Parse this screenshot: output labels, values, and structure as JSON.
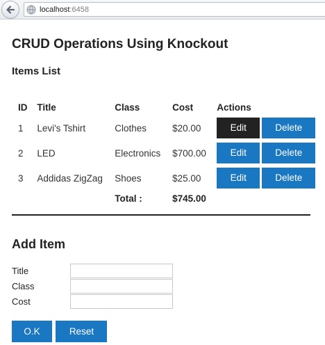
{
  "browser": {
    "url_host": "localhost",
    "url_port": ":6458",
    "icons": {
      "back": "back-arrow-icon",
      "site": "globe-icon"
    }
  },
  "page": {
    "title": "CRUD Operations Using Knockout",
    "list_title": "Items List"
  },
  "items_table": {
    "headers": {
      "id": "ID",
      "title": "Title",
      "class": "Class",
      "cost": "Cost",
      "actions": "Actions"
    },
    "rows": [
      {
        "id": "1",
        "title": "Levi's Tshirt",
        "class": "Clothes",
        "cost": "$20.00",
        "edit": "Edit",
        "delete": "Delete",
        "edit_active": true
      },
      {
        "id": "2",
        "title": "LED",
        "class": "Electronics",
        "cost": "$700.00",
        "edit": "Edit",
        "delete": "Delete",
        "edit_active": false
      },
      {
        "id": "3",
        "title": "Addidas ZigZag",
        "class": "Shoes",
        "cost": "$25.00",
        "edit": "Edit",
        "delete": "Delete",
        "edit_active": false
      }
    ],
    "total_label": "Total :",
    "total_value": "$745.00"
  },
  "add_item": {
    "title": "Add Item",
    "fields": {
      "title": {
        "label": "Title",
        "value": ""
      },
      "class": {
        "label": "Class",
        "value": ""
      },
      "cost": {
        "label": "Cost",
        "value": ""
      }
    },
    "ok_label": "O.K",
    "reset_label": "Reset"
  },
  "colors": {
    "button_primary": "#1a78c2",
    "button_active": "#222222",
    "text": "#333333"
  }
}
